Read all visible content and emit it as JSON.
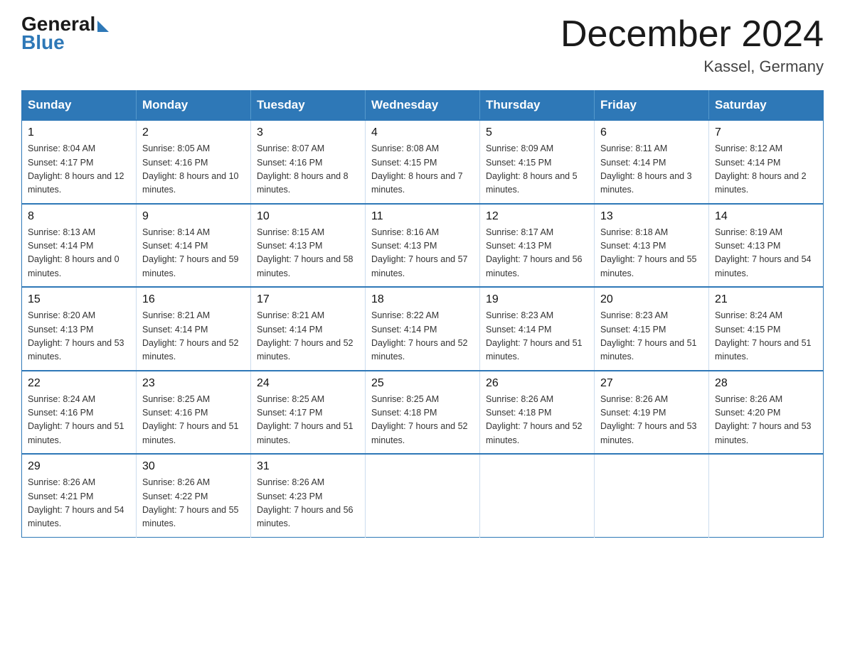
{
  "header": {
    "logo_general": "General",
    "logo_blue": "Blue",
    "month_title": "December 2024",
    "location": "Kassel, Germany"
  },
  "days_of_week": [
    "Sunday",
    "Monday",
    "Tuesday",
    "Wednesday",
    "Thursday",
    "Friday",
    "Saturday"
  ],
  "weeks": [
    [
      {
        "day": "1",
        "sunrise": "Sunrise: 8:04 AM",
        "sunset": "Sunset: 4:17 PM",
        "daylight": "Daylight: 8 hours and 12 minutes."
      },
      {
        "day": "2",
        "sunrise": "Sunrise: 8:05 AM",
        "sunset": "Sunset: 4:16 PM",
        "daylight": "Daylight: 8 hours and 10 minutes."
      },
      {
        "day": "3",
        "sunrise": "Sunrise: 8:07 AM",
        "sunset": "Sunset: 4:16 PM",
        "daylight": "Daylight: 8 hours and 8 minutes."
      },
      {
        "day": "4",
        "sunrise": "Sunrise: 8:08 AM",
        "sunset": "Sunset: 4:15 PM",
        "daylight": "Daylight: 8 hours and 7 minutes."
      },
      {
        "day": "5",
        "sunrise": "Sunrise: 8:09 AM",
        "sunset": "Sunset: 4:15 PM",
        "daylight": "Daylight: 8 hours and 5 minutes."
      },
      {
        "day": "6",
        "sunrise": "Sunrise: 8:11 AM",
        "sunset": "Sunset: 4:14 PM",
        "daylight": "Daylight: 8 hours and 3 minutes."
      },
      {
        "day": "7",
        "sunrise": "Sunrise: 8:12 AM",
        "sunset": "Sunset: 4:14 PM",
        "daylight": "Daylight: 8 hours and 2 minutes."
      }
    ],
    [
      {
        "day": "8",
        "sunrise": "Sunrise: 8:13 AM",
        "sunset": "Sunset: 4:14 PM",
        "daylight": "Daylight: 8 hours and 0 minutes."
      },
      {
        "day": "9",
        "sunrise": "Sunrise: 8:14 AM",
        "sunset": "Sunset: 4:14 PM",
        "daylight": "Daylight: 7 hours and 59 minutes."
      },
      {
        "day": "10",
        "sunrise": "Sunrise: 8:15 AM",
        "sunset": "Sunset: 4:13 PM",
        "daylight": "Daylight: 7 hours and 58 minutes."
      },
      {
        "day": "11",
        "sunrise": "Sunrise: 8:16 AM",
        "sunset": "Sunset: 4:13 PM",
        "daylight": "Daylight: 7 hours and 57 minutes."
      },
      {
        "day": "12",
        "sunrise": "Sunrise: 8:17 AM",
        "sunset": "Sunset: 4:13 PM",
        "daylight": "Daylight: 7 hours and 56 minutes."
      },
      {
        "day": "13",
        "sunrise": "Sunrise: 8:18 AM",
        "sunset": "Sunset: 4:13 PM",
        "daylight": "Daylight: 7 hours and 55 minutes."
      },
      {
        "day": "14",
        "sunrise": "Sunrise: 8:19 AM",
        "sunset": "Sunset: 4:13 PM",
        "daylight": "Daylight: 7 hours and 54 minutes."
      }
    ],
    [
      {
        "day": "15",
        "sunrise": "Sunrise: 8:20 AM",
        "sunset": "Sunset: 4:13 PM",
        "daylight": "Daylight: 7 hours and 53 minutes."
      },
      {
        "day": "16",
        "sunrise": "Sunrise: 8:21 AM",
        "sunset": "Sunset: 4:14 PM",
        "daylight": "Daylight: 7 hours and 52 minutes."
      },
      {
        "day": "17",
        "sunrise": "Sunrise: 8:21 AM",
        "sunset": "Sunset: 4:14 PM",
        "daylight": "Daylight: 7 hours and 52 minutes."
      },
      {
        "day": "18",
        "sunrise": "Sunrise: 8:22 AM",
        "sunset": "Sunset: 4:14 PM",
        "daylight": "Daylight: 7 hours and 52 minutes."
      },
      {
        "day": "19",
        "sunrise": "Sunrise: 8:23 AM",
        "sunset": "Sunset: 4:14 PM",
        "daylight": "Daylight: 7 hours and 51 minutes."
      },
      {
        "day": "20",
        "sunrise": "Sunrise: 8:23 AM",
        "sunset": "Sunset: 4:15 PM",
        "daylight": "Daylight: 7 hours and 51 minutes."
      },
      {
        "day": "21",
        "sunrise": "Sunrise: 8:24 AM",
        "sunset": "Sunset: 4:15 PM",
        "daylight": "Daylight: 7 hours and 51 minutes."
      }
    ],
    [
      {
        "day": "22",
        "sunrise": "Sunrise: 8:24 AM",
        "sunset": "Sunset: 4:16 PM",
        "daylight": "Daylight: 7 hours and 51 minutes."
      },
      {
        "day": "23",
        "sunrise": "Sunrise: 8:25 AM",
        "sunset": "Sunset: 4:16 PM",
        "daylight": "Daylight: 7 hours and 51 minutes."
      },
      {
        "day": "24",
        "sunrise": "Sunrise: 8:25 AM",
        "sunset": "Sunset: 4:17 PM",
        "daylight": "Daylight: 7 hours and 51 minutes."
      },
      {
        "day": "25",
        "sunrise": "Sunrise: 8:25 AM",
        "sunset": "Sunset: 4:18 PM",
        "daylight": "Daylight: 7 hours and 52 minutes."
      },
      {
        "day": "26",
        "sunrise": "Sunrise: 8:26 AM",
        "sunset": "Sunset: 4:18 PM",
        "daylight": "Daylight: 7 hours and 52 minutes."
      },
      {
        "day": "27",
        "sunrise": "Sunrise: 8:26 AM",
        "sunset": "Sunset: 4:19 PM",
        "daylight": "Daylight: 7 hours and 53 minutes."
      },
      {
        "day": "28",
        "sunrise": "Sunrise: 8:26 AM",
        "sunset": "Sunset: 4:20 PM",
        "daylight": "Daylight: 7 hours and 53 minutes."
      }
    ],
    [
      {
        "day": "29",
        "sunrise": "Sunrise: 8:26 AM",
        "sunset": "Sunset: 4:21 PM",
        "daylight": "Daylight: 7 hours and 54 minutes."
      },
      {
        "day": "30",
        "sunrise": "Sunrise: 8:26 AM",
        "sunset": "Sunset: 4:22 PM",
        "daylight": "Daylight: 7 hours and 55 minutes."
      },
      {
        "day": "31",
        "sunrise": "Sunrise: 8:26 AM",
        "sunset": "Sunset: 4:23 PM",
        "daylight": "Daylight: 7 hours and 56 minutes."
      },
      null,
      null,
      null,
      null
    ]
  ]
}
